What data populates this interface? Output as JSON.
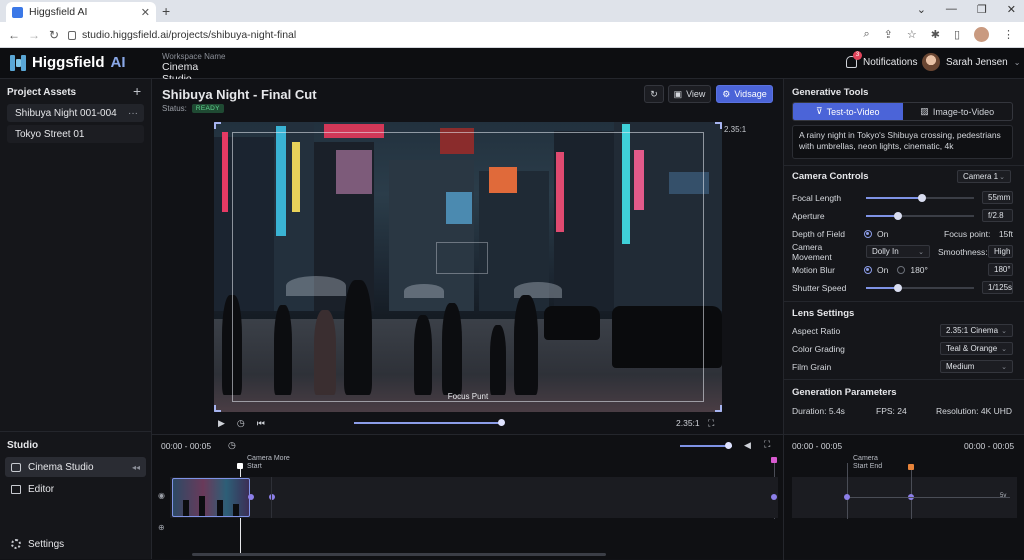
{
  "browser": {
    "tab_title": "Higgsfield AI",
    "new_tab": "+",
    "url": "studio.higgsfield.ai/projects/shibuya-night-final"
  },
  "header": {
    "brand": "Higgsfield",
    "brand_accent": "AI",
    "workspace_label": "Workspace Name",
    "workspace_value": "Cinema Studio",
    "notifications_label": "Notifications",
    "notifications_count": "3",
    "user_name": "Sarah Jensen"
  },
  "sidebar": {
    "assets_title": "Project Assets",
    "assets": [
      {
        "label": "Shibuya Night 001-004"
      },
      {
        "label": "Tokyo Street 01"
      }
    ],
    "studio_title": "Studio",
    "studio_items": [
      {
        "label": "Cinema Studio"
      },
      {
        "label": "Editor"
      }
    ],
    "settings_label": "Settings"
  },
  "main": {
    "title": "Shibuya Night - Final Cut",
    "status_label": "Status:",
    "status_value": "READY",
    "view_label": "View",
    "generate_label": "Vidsage",
    "aspect_top": "2.35:1",
    "aspect_bottom": "2.35:1",
    "focus_label": "Focus Punt",
    "progress": 0.99
  },
  "panel": {
    "title": "Generative Tools",
    "tab_text_to_video": "Test-to-Video",
    "tab_image_to_video": "Image-to-Video",
    "prompt": "A rainy night in Tokyo's Shibuya crossing, pedestrians with umbrellas, neon lights, cinematic, 4k",
    "camera_controls_title": "Camera Controls",
    "camera_select": "Camera 1",
    "focal_length_label": "Focal Length",
    "focal_length_value": "55mm",
    "focal_length_level": 0.52,
    "aperture_label": "Aperture",
    "aperture_value": "f/2.8",
    "aperture_level": 0.3,
    "dof_label": "Depth of Field",
    "dof_value": "On",
    "focus_point_label": "Focus point:",
    "focus_point_value": "15ft",
    "movement_label": "Camera Movement",
    "movement_value": "Dolly In",
    "smoothness_label": "Smoothness:",
    "smoothness_value": "High",
    "motion_blur_label": "Motion Blur",
    "motion_blur_on": "On",
    "motion_blur_angle": "180°",
    "motion_blur_value": "180°",
    "shutter_label": "Shutter Speed",
    "shutter_value": "1/125s",
    "shutter_level": 0.3,
    "lens_title": "Lens Settings",
    "aspect_label": "Aspect Ratio",
    "aspect_value": "2.35:1 Cinema",
    "grading_label": "Color Grading",
    "grading_value": "Teal & Orange",
    "grain_label": "Film Grain",
    "grain_value": "Medium",
    "gen_title": "Generation Parameters",
    "duration": "Duration: 5.4s",
    "fps": "FPS: 24",
    "resolution": "Resolution: 4K UHD"
  },
  "timeline": {
    "range_left": "00:00 - 00:05",
    "range_right_a": "00:00 - 00:05",
    "range_right_b": "00:00 - 00:05",
    "marker_top": "Camera More",
    "marker_bottom": "Start",
    "right_marker_top": "Camera",
    "right_marker_bottom": "Start End",
    "right_track_tag": "5v"
  },
  "colors": {
    "accent": "#4b64d8",
    "ready": "#5fd68f",
    "keyframe": "#8c7fe8"
  }
}
